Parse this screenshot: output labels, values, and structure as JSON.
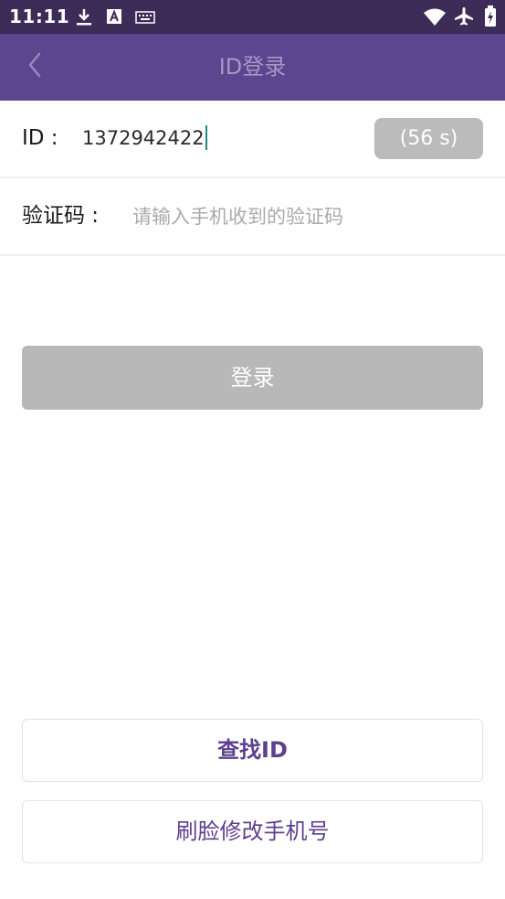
{
  "status_bar": {
    "time": "11:11",
    "icons": [
      "download-icon",
      "font-a-icon",
      "keyboard-icon",
      "wifi-icon",
      "airplane-icon",
      "battery-charging-icon"
    ]
  },
  "header": {
    "title": "ID登录",
    "back_icon": "chevron-left-icon"
  },
  "form": {
    "id_label": "ID :",
    "id_value": "1372942422",
    "countdown_label": "(56 s)",
    "code_label": "验证码 :",
    "code_placeholder": "请输入手机收到的验证码",
    "code_value": ""
  },
  "login_button": {
    "label": "登录"
  },
  "bottom": {
    "find_id_label": "查找ID",
    "face_change_phone_label": "刷脸修改手机号"
  },
  "colors": {
    "status_bar": "#3d2c58",
    "title_bar": "#5d4590",
    "title_text": "#a898c6",
    "accent_text": "#5d3f8f",
    "disabled_button": "#b8b8b8"
  }
}
